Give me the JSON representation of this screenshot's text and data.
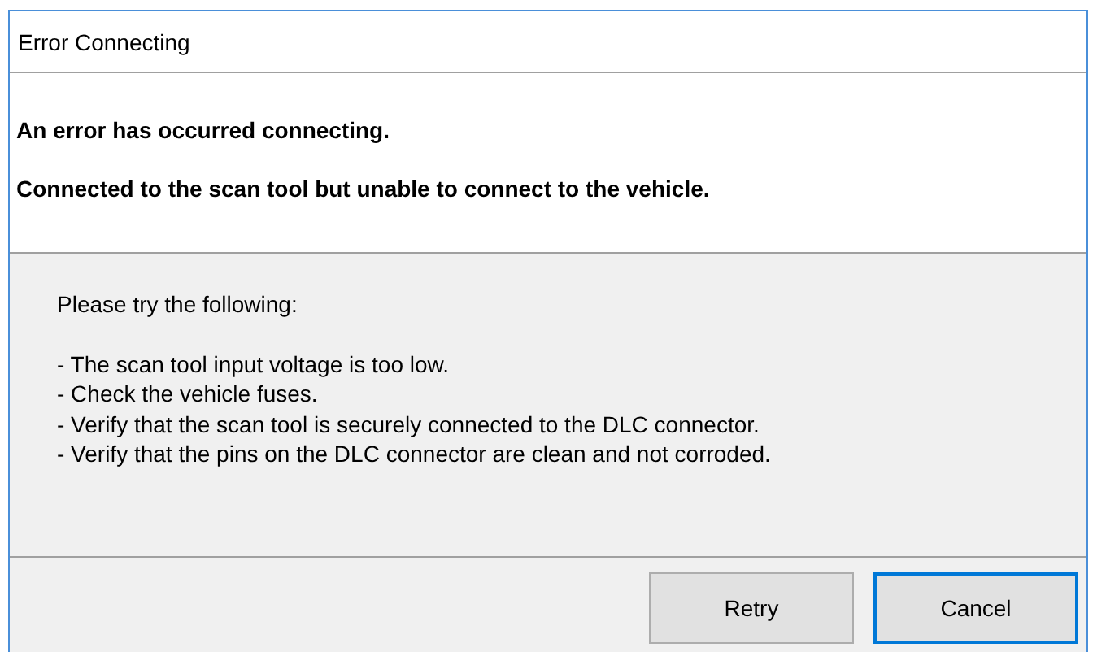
{
  "window": {
    "title": "Error Connecting"
  },
  "messages": [
    "An error has occurred connecting.",
    "Connected to the scan tool but unable to connect to the vehicle."
  ],
  "details": {
    "intro": "Please try the following:",
    "items": [
      "- The scan tool input voltage is too low.",
      "- Check the vehicle fuses.",
      "- Verify that the scan tool is securely connected to the DLC connector.",
      "- Verify that the pins on the DLC connector are clean and not corroded."
    ]
  },
  "buttons": [
    {
      "label": "Retry",
      "focused": false
    },
    {
      "label": "Cancel",
      "focused": true
    }
  ]
}
